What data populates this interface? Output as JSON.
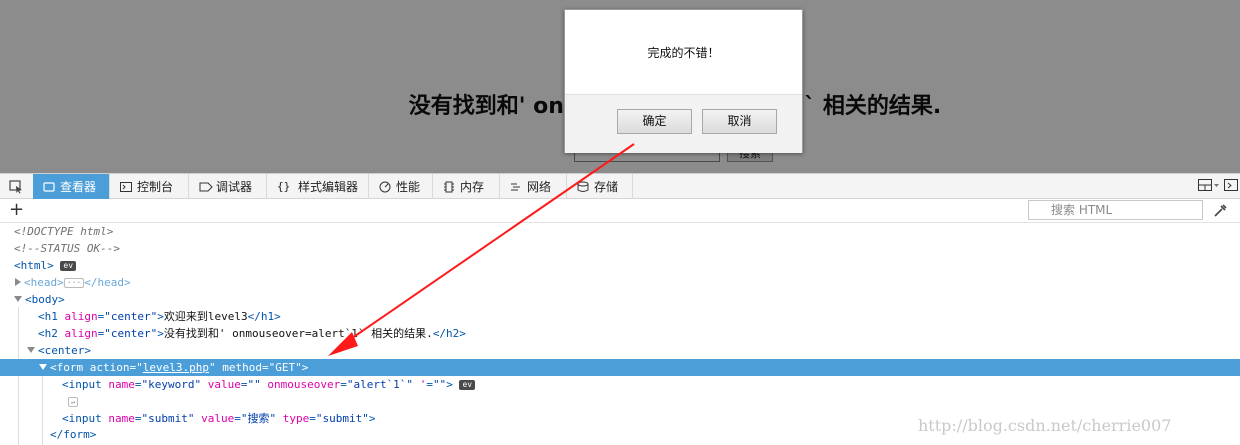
{
  "page": {
    "heading": "没有找到和' onmouseover=alert`1` 相关的结果.",
    "search_button": "搜索"
  },
  "dialog": {
    "message": "完成的不错！",
    "ok_label": "确定",
    "cancel_label": "取消"
  },
  "devtools": {
    "tabs": [
      {
        "label": "查看器",
        "icon": "inspector-icon",
        "active": true
      },
      {
        "label": "控制台",
        "icon": "console-icon",
        "active": false
      },
      {
        "label": "调试器",
        "icon": "debugger-icon",
        "active": false
      },
      {
        "label": "样式编辑器",
        "icon": "style-editor-icon",
        "active": false
      },
      {
        "label": "性能",
        "icon": "performance-icon",
        "active": false
      },
      {
        "label": "内存",
        "icon": "memory-icon",
        "active": false
      },
      {
        "label": "网络",
        "icon": "network-icon",
        "active": false
      },
      {
        "label": "存储",
        "icon": "storage-icon",
        "active": false
      }
    ],
    "search_placeholder": "搜索 HTML",
    "accent_color": "#4c9ed9"
  },
  "tree": {
    "doctype": "<!DOCTYPE html>",
    "comment": "<!--STATUS OK-->",
    "html_open": "<html>",
    "head_open": "<head>",
    "head_close": "</head>",
    "body_open": "<body>",
    "h1": {
      "open": "<h1 ",
      "attr": "align",
      "eq": "=",
      "val": "\"center\"",
      "gt": ">",
      "text": "欢迎来到level3",
      "close": "</h1>"
    },
    "h2": {
      "open": "<h2 ",
      "attr": "align",
      "eq": "=",
      "val": "\"center\"",
      "gt": ">",
      "text": "没有找到和' onmouseover=alert`1` 相关的结果.",
      "close": "</h2>"
    },
    "center_open": "<center>",
    "form": {
      "open": "<form ",
      "attr1": "action",
      "val1": "level3.php",
      "attr2": "method",
      "val2": "\"GET\"",
      "gt": ">"
    },
    "input1": {
      "open": "<input ",
      "attr1": "name",
      "val1": "\"keyword\"",
      "attr2": "value",
      "val2": "\"\"",
      "attr3": "onmouseover",
      "val3": "\"alert`1`\"",
      "attr4": "'",
      "val4": "\"\"",
      "gt": ">"
    },
    "input2": {
      "open": "<input ",
      "attr1": "name",
      "val1": "\"submit\"",
      "attr2": "value",
      "val2": "\"搜索\"",
      "attr3": "type",
      "val3": "\"submit\"",
      "gt": ">"
    },
    "form_close": "</form>",
    "ev_badge": "ev"
  },
  "watermark": "http://blog.csdn.net/cherrie007"
}
